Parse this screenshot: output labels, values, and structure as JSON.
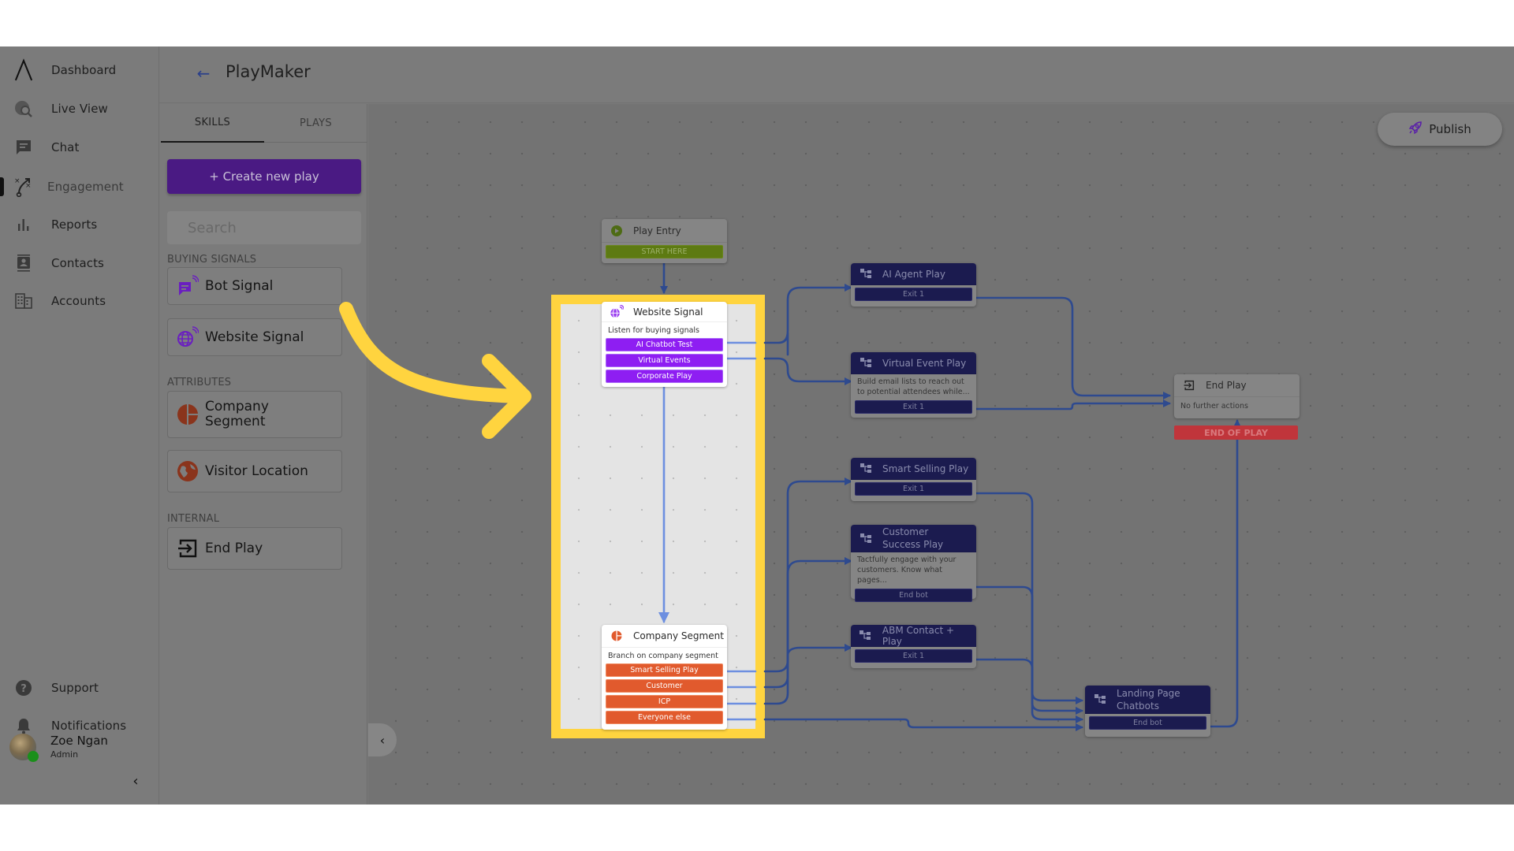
{
  "app": {
    "nav": {
      "items": [
        {
          "label": "Dashboard",
          "icon": "logo-caret-icon"
        },
        {
          "label": "Live View",
          "icon": "globe-search-icon"
        },
        {
          "label": "Chat",
          "icon": "chat-bubble-icon"
        },
        {
          "label": "Engagement",
          "icon": "playbook-icon",
          "active": true
        },
        {
          "label": "Reports",
          "icon": "bar-chart-icon"
        },
        {
          "label": "Contacts",
          "icon": "contact-card-icon"
        },
        {
          "label": "Accounts",
          "icon": "building-icon"
        }
      ],
      "bottom": [
        {
          "label": "Support",
          "icon": "help-circle-icon"
        },
        {
          "label": "Notifications",
          "icon": "bell-icon"
        }
      ],
      "user": {
        "name": "Zoe Ngan",
        "role": "Admin",
        "status": "online"
      },
      "collapse_glyph": "‹"
    },
    "header": {
      "back_glyph": "←",
      "title": "PlayMaker"
    }
  },
  "panel": {
    "tabs": [
      {
        "label": "SKILLS",
        "active": true
      },
      {
        "label": "PLAYS",
        "active": false
      }
    ],
    "create_button": "+ Create new play",
    "search_placeholder": "Search",
    "sections": [
      {
        "title": "BUYING SIGNALS",
        "items": [
          {
            "label": "Bot Signal",
            "icon": "bot-signal-icon"
          },
          {
            "label": "Website Signal",
            "icon": "website-signal-icon"
          }
        ]
      },
      {
        "title": "ATTRIBUTES",
        "items": [
          {
            "label": "Company Segment",
            "icon": "pie-segment-icon"
          },
          {
            "label": "Visitor Location",
            "icon": "globe-location-icon"
          }
        ]
      },
      {
        "title": "INTERNAL",
        "items": [
          {
            "label": "End Play",
            "icon": "exit-icon"
          }
        ]
      }
    ]
  },
  "canvas": {
    "publish_button": "Publish",
    "collapse_glyph": "‹",
    "nodes": {
      "play_entry": {
        "title": "Play Entry",
        "ports": [
          "START HERE"
        ]
      },
      "website_signal": {
        "title": "Website Signal",
        "description": "Listen for buying signals",
        "ports": [
          "AI Chatbot Test",
          "Virtual Events",
          "Corporate Play"
        ]
      },
      "company_segment": {
        "title": "Company Segment",
        "description": "Branch on company segment",
        "ports": [
          "Smart Selling Play",
          "Customer",
          "ICP",
          "Everyone else"
        ]
      },
      "ai_agent_play": {
        "title": "AI Agent Play",
        "ports": [
          "Exit 1"
        ]
      },
      "virtual_event_play": {
        "title": "Virtual Event Play",
        "description": "Build email lists to reach out to potential attendees while...",
        "ports": [
          "Exit 1"
        ]
      },
      "smart_selling_play": {
        "title": "Smart Selling Play",
        "ports": [
          "Exit 1"
        ]
      },
      "customer_success_play": {
        "title": "Customer Success Play",
        "description": "Tactfully engage with your customers. Know what pages...",
        "ports": [
          "End bot"
        ]
      },
      "abm_contact_play": {
        "title": "ABM Contact + Play",
        "ports": [
          "Exit 1"
        ]
      },
      "landing_page_chatbots": {
        "title": "Landing Page Chatbots",
        "ports": [
          "End bot"
        ]
      },
      "end_play": {
        "title": "End Play",
        "description": "No further actions",
        "badge": "END OF PLAY"
      }
    },
    "toolbar": [
      "keyboard-shortcuts",
      "fit-view",
      "zoom-in",
      "zoom-out",
      "pan-mode",
      "select-mode",
      "fullscreen"
    ]
  },
  "annotation": {
    "highlight_color": "#ffd43f",
    "arrow_color": "#ffd43f"
  },
  "colors": {
    "brand_purple": "#4a1a83",
    "signal_purple": "#8e1ef2",
    "segment_orange": "#e15a2d",
    "play_navy": "#1b1b4f",
    "entry_green": "#5d7a12",
    "end_red": "#c0353b",
    "wire_blue": "#2e4a8f"
  }
}
